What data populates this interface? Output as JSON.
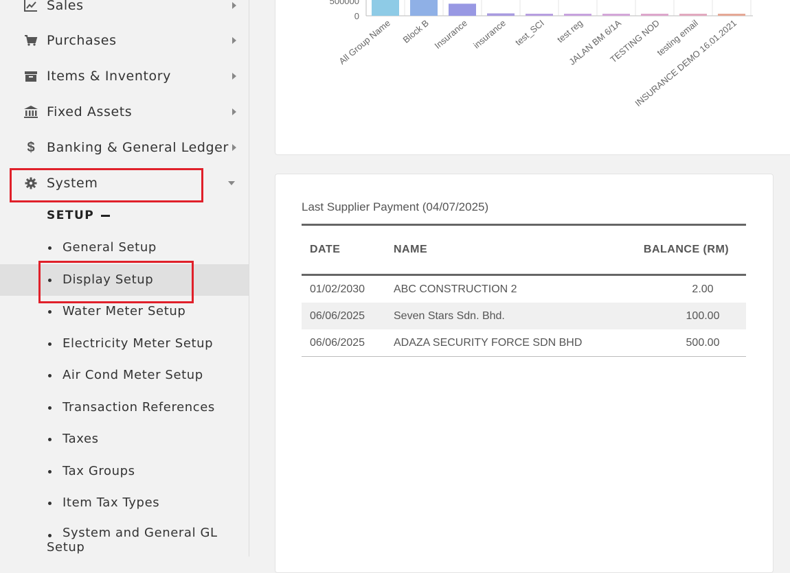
{
  "sidebar": {
    "items": [
      {
        "label": "Sales",
        "icon": "chart-line-icon"
      },
      {
        "label": "Purchases",
        "icon": "shopping-cart-icon"
      },
      {
        "label": "Items & Inventory",
        "icon": "archive-icon"
      },
      {
        "label": "Fixed Assets",
        "icon": "bank-icon"
      },
      {
        "label": "Banking & General Ledger",
        "icon": "dollar-icon"
      },
      {
        "label": "System",
        "icon": "gear-icon"
      }
    ],
    "setup_heading": "SETUP",
    "sub_items": [
      "General Setup",
      "Display Setup",
      "Water Meter Setup",
      "Electricity Meter Setup",
      "Air Cond Meter Setup",
      "Transaction References",
      "Taxes",
      "Tax Groups",
      "Item Tax Types"
    ],
    "last_item_line1": "System and General GL",
    "last_item_line2": "Setup",
    "active_item": "Display Setup"
  },
  "chart_data": {
    "type": "bar",
    "categories": [
      "All Group Name",
      "Block B",
      "Insurance",
      "insurance",
      "test_SCI",
      "test reg",
      "JALAN BM 6/1A",
      "TESTING NOD",
      "testing email",
      "INSURANCE DEMO 16.01.2021"
    ],
    "values": [
      900000,
      900000,
      400000,
      80000,
      60000,
      40000,
      40000,
      30000,
      30000,
      30000
    ],
    "colors": [
      "#8ecbe6",
      "#8fb0e6",
      "#9898e3",
      "#a89be0",
      "#b79ee0",
      "#c7a2de",
      "#d4a6d9",
      "#dda6cc",
      "#e2a9bf",
      "#e6a896"
    ],
    "y_tick_labels": [
      "0",
      "500000"
    ]
  },
  "payments": {
    "title": "Last Supplier Payment (04/07/2025)",
    "headers": [
      "DATE",
      "NAME",
      "BALANCE (RM)"
    ],
    "rows": [
      [
        "01/02/2030",
        "ABC CONSTRUCTION 2",
        "2.00"
      ],
      [
        "06/06/2025",
        "Seven Stars Sdn. Bhd.",
        "100.00"
      ],
      [
        "06/06/2025",
        "ADAZA SECURITY FORCE SDN BHD",
        "500.00"
      ]
    ]
  }
}
